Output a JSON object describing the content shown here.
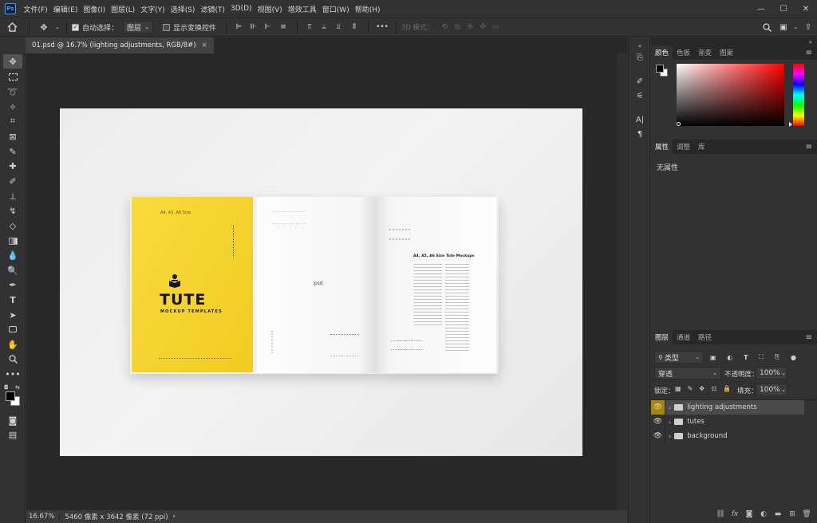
{
  "app": {
    "logo": "Ps",
    "accent": "#31a8ff"
  },
  "menubar": {
    "items": [
      "文件(F)",
      "编辑(E)",
      "图像(I)",
      "图层(L)",
      "文字(Y)",
      "选择(S)",
      "滤镜(T)",
      "3D(D)",
      "视图(V)",
      "增效工具",
      "窗口(W)",
      "帮助(H)"
    ],
    "window_controls": {
      "minimize": "—",
      "maximize": "☐",
      "close": "✕"
    }
  },
  "options": {
    "auto_select_label": "自动选择：",
    "auto_select_checked": true,
    "layer_select_value": "图层",
    "show_transform_label": "显示变换控件",
    "mode_3d_label": "3D 模式：",
    "more": "•••"
  },
  "document": {
    "tab_title": "01.psd @ 16.7% (lighting adjustments, RGB/8#)",
    "tab_close": "×",
    "zoom": "16.67%",
    "size_info": "5460 像素 x 3642 像素 (72 ppi)",
    "status_arrow": "›"
  },
  "mockup": {
    "cover_size_label": "A4, A5, A6 Size",
    "cover_title": "TUTE",
    "cover_subtitle": "MOCKUP TEMPLATES",
    "cover_color": "#f6d22d",
    "left_page_label": ".psd",
    "right_page_title": "A4, A5, A6 Size Tute Mockups"
  },
  "color_panel": {
    "tabs": [
      "颜色",
      "色板",
      "渐变",
      "图案"
    ],
    "active": 0,
    "menu_icon": "hamburger-icon",
    "hue": "#ff0000"
  },
  "properties_panel": {
    "tabs": [
      "属性",
      "调整",
      "库"
    ],
    "active": 0,
    "empty_text": "无属性"
  },
  "layers_panel": {
    "tabs": [
      "图层",
      "通道",
      "路径"
    ],
    "active": 0,
    "filter_label": "类型",
    "blend_mode": "穿透",
    "opacity_label": "不透明度：",
    "opacity_value": "100%",
    "lock_label": "锁定：",
    "fill_label": "填充：",
    "fill_value": "100%",
    "layers": [
      {
        "name": "lighting adjustments",
        "selected": true
      },
      {
        "name": "tutes",
        "selected": false
      },
      {
        "name": "background",
        "selected": false
      }
    ],
    "bottom_icons": [
      "link-icon",
      "fx-icon",
      "mask-icon",
      "adjustment-icon",
      "folder-icon",
      "new-layer-icon",
      "trash-icon"
    ]
  }
}
